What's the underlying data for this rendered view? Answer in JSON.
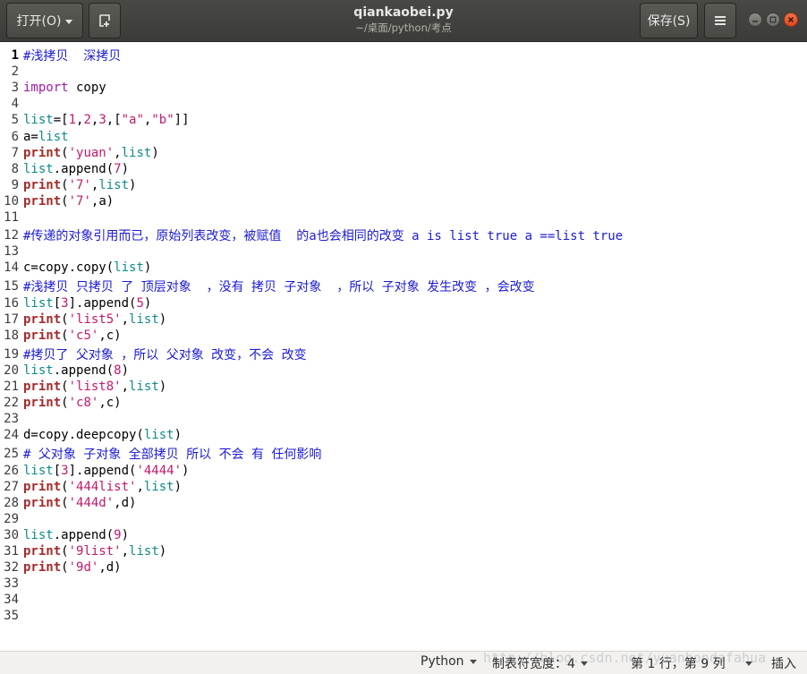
{
  "header": {
    "open_label": "打开(O)",
    "save_label": "保存(S)",
    "title": "qiankaobei.py",
    "subtitle": "~/桌面/python/考点"
  },
  "editor": {
    "lines": [
      {
        "n": "1",
        "current": true,
        "tokens": [
          {
            "t": "cmt",
            "v": "#浅拷贝  深拷贝"
          }
        ]
      },
      {
        "n": "2",
        "tokens": []
      },
      {
        "n": "3",
        "tokens": [
          {
            "t": "imp",
            "v": "import"
          },
          {
            "t": "pl",
            "v": " copy"
          }
        ]
      },
      {
        "n": "4",
        "tokens": []
      },
      {
        "n": "5",
        "tokens": [
          {
            "t": "bi",
            "v": "list"
          },
          {
            "t": "pl",
            "v": "=["
          },
          {
            "t": "num",
            "v": "1"
          },
          {
            "t": "pl",
            "v": ","
          },
          {
            "t": "num",
            "v": "2"
          },
          {
            "t": "pl",
            "v": ","
          },
          {
            "t": "num",
            "v": "3"
          },
          {
            "t": "pl",
            "v": ",["
          },
          {
            "t": "str",
            "v": "\"a\""
          },
          {
            "t": "pl",
            "v": ","
          },
          {
            "t": "str",
            "v": "\"b\""
          },
          {
            "t": "pl",
            "v": "]]"
          }
        ]
      },
      {
        "n": "6",
        "tokens": [
          {
            "t": "pl",
            "v": "a="
          },
          {
            "t": "bi",
            "v": "list"
          }
        ]
      },
      {
        "n": "7",
        "tokens": [
          {
            "t": "kw",
            "v": "print"
          },
          {
            "t": "pl",
            "v": "("
          },
          {
            "t": "str",
            "v": "'yuan'"
          },
          {
            "t": "pl",
            "v": ","
          },
          {
            "t": "bi",
            "v": "list"
          },
          {
            "t": "pl",
            "v": ")"
          }
        ]
      },
      {
        "n": "8",
        "tokens": [
          {
            "t": "bi",
            "v": "list"
          },
          {
            "t": "pl",
            "v": ".append("
          },
          {
            "t": "num",
            "v": "7"
          },
          {
            "t": "pl",
            "v": ")"
          }
        ]
      },
      {
        "n": "9",
        "tokens": [
          {
            "t": "kw",
            "v": "print"
          },
          {
            "t": "pl",
            "v": "("
          },
          {
            "t": "str",
            "v": "'7'"
          },
          {
            "t": "pl",
            "v": ","
          },
          {
            "t": "bi",
            "v": "list"
          },
          {
            "t": "pl",
            "v": ")"
          }
        ]
      },
      {
        "n": "10",
        "tokens": [
          {
            "t": "kw",
            "v": "print"
          },
          {
            "t": "pl",
            "v": "("
          },
          {
            "t": "str",
            "v": "'7'"
          },
          {
            "t": "pl",
            "v": ",a)"
          }
        ]
      },
      {
        "n": "11",
        "tokens": []
      },
      {
        "n": "12",
        "tokens": [
          {
            "t": "cmt",
            "v": "#传递的对象引用而已，原始列表改变，被赋值  的a也会相同的改变 a is list true a ==list true"
          }
        ]
      },
      {
        "n": "13",
        "tokens": []
      },
      {
        "n": "14",
        "tokens": [
          {
            "t": "pl",
            "v": "c=copy.copy("
          },
          {
            "t": "bi",
            "v": "list"
          },
          {
            "t": "pl",
            "v": ")"
          }
        ]
      },
      {
        "n": "15",
        "tokens": [
          {
            "t": "cmt",
            "v": "#浅拷贝 只拷贝 了 顶层对象  ，没有 拷贝 子对象  ，所以 子对象 发生改变 ，会改变"
          }
        ]
      },
      {
        "n": "16",
        "tokens": [
          {
            "t": "bi",
            "v": "list"
          },
          {
            "t": "pl",
            "v": "["
          },
          {
            "t": "num",
            "v": "3"
          },
          {
            "t": "pl",
            "v": "].append("
          },
          {
            "t": "num",
            "v": "5"
          },
          {
            "t": "pl",
            "v": ")"
          }
        ]
      },
      {
        "n": "17",
        "tokens": [
          {
            "t": "kw",
            "v": "print"
          },
          {
            "t": "pl",
            "v": "("
          },
          {
            "t": "str",
            "v": "'list5'"
          },
          {
            "t": "pl",
            "v": ","
          },
          {
            "t": "bi",
            "v": "list"
          },
          {
            "t": "pl",
            "v": ")"
          }
        ]
      },
      {
        "n": "18",
        "tokens": [
          {
            "t": "kw",
            "v": "print"
          },
          {
            "t": "pl",
            "v": "("
          },
          {
            "t": "str",
            "v": "'c5'"
          },
          {
            "t": "pl",
            "v": ",c)"
          }
        ]
      },
      {
        "n": "19",
        "tokens": [
          {
            "t": "cmt",
            "v": "#拷贝了 父对象 ，所以 父对象 改变，不会 改变"
          }
        ]
      },
      {
        "n": "20",
        "tokens": [
          {
            "t": "bi",
            "v": "list"
          },
          {
            "t": "pl",
            "v": ".append("
          },
          {
            "t": "num",
            "v": "8"
          },
          {
            "t": "pl",
            "v": ")"
          }
        ]
      },
      {
        "n": "21",
        "tokens": [
          {
            "t": "kw",
            "v": "print"
          },
          {
            "t": "pl",
            "v": "("
          },
          {
            "t": "str",
            "v": "'list8'"
          },
          {
            "t": "pl",
            "v": ","
          },
          {
            "t": "bi",
            "v": "list"
          },
          {
            "t": "pl",
            "v": ")"
          }
        ]
      },
      {
        "n": "22",
        "tokens": [
          {
            "t": "kw",
            "v": "print"
          },
          {
            "t": "pl",
            "v": "("
          },
          {
            "t": "str",
            "v": "'c8'"
          },
          {
            "t": "pl",
            "v": ",c)"
          }
        ]
      },
      {
        "n": "23",
        "tokens": []
      },
      {
        "n": "24",
        "tokens": [
          {
            "t": "pl",
            "v": "d=copy.deepcopy("
          },
          {
            "t": "bi",
            "v": "list"
          },
          {
            "t": "pl",
            "v": ")"
          }
        ]
      },
      {
        "n": "25",
        "tokens": [
          {
            "t": "cmt",
            "v": "# 父对象 子对象 全部拷贝 所以 不会 有 任何影响"
          }
        ]
      },
      {
        "n": "26",
        "tokens": [
          {
            "t": "bi",
            "v": "list"
          },
          {
            "t": "pl",
            "v": "["
          },
          {
            "t": "num",
            "v": "3"
          },
          {
            "t": "pl",
            "v": "].append("
          },
          {
            "t": "str",
            "v": "'4444'"
          },
          {
            "t": "pl",
            "v": ")"
          }
        ]
      },
      {
        "n": "27",
        "tokens": [
          {
            "t": "kw",
            "v": "print"
          },
          {
            "t": "pl",
            "v": "("
          },
          {
            "t": "str",
            "v": "'444list'"
          },
          {
            "t": "pl",
            "v": ","
          },
          {
            "t": "bi",
            "v": "list"
          },
          {
            "t": "pl",
            "v": ")"
          }
        ]
      },
      {
        "n": "28",
        "tokens": [
          {
            "t": "kw",
            "v": "print"
          },
          {
            "t": "pl",
            "v": "("
          },
          {
            "t": "str",
            "v": "'444d'"
          },
          {
            "t": "pl",
            "v": ",d)"
          }
        ]
      },
      {
        "n": "29",
        "tokens": []
      },
      {
        "n": "30",
        "tokens": [
          {
            "t": "bi",
            "v": "list"
          },
          {
            "t": "pl",
            "v": ".append("
          },
          {
            "t": "num",
            "v": "9"
          },
          {
            "t": "pl",
            "v": ")"
          }
        ]
      },
      {
        "n": "31",
        "tokens": [
          {
            "t": "kw",
            "v": "print"
          },
          {
            "t": "pl",
            "v": "("
          },
          {
            "t": "str",
            "v": "'9list'"
          },
          {
            "t": "pl",
            "v": ","
          },
          {
            "t": "bi",
            "v": "list"
          },
          {
            "t": "pl",
            "v": ")"
          }
        ]
      },
      {
        "n": "32",
        "tokens": [
          {
            "t": "kw",
            "v": "print"
          },
          {
            "t": "pl",
            "v": "("
          },
          {
            "t": "str",
            "v": "'9d'"
          },
          {
            "t": "pl",
            "v": ",d)"
          }
        ]
      },
      {
        "n": "33",
        "tokens": []
      },
      {
        "n": "34",
        "tokens": []
      },
      {
        "n": "35",
        "tokens": []
      }
    ]
  },
  "status": {
    "language": "Python",
    "tab_width": "制表符宽度：4",
    "position": "第 1 行，第 9 列",
    "insert_mode": "插入",
    "watermark": "http://blog.csdn.net/yuanhondafahua"
  },
  "colors": {
    "comment": "#1b1bd6",
    "import": "#a41aa8",
    "builtin": "#0f8a8a",
    "keyword": "#a52a2a",
    "string": "#c3186a"
  }
}
